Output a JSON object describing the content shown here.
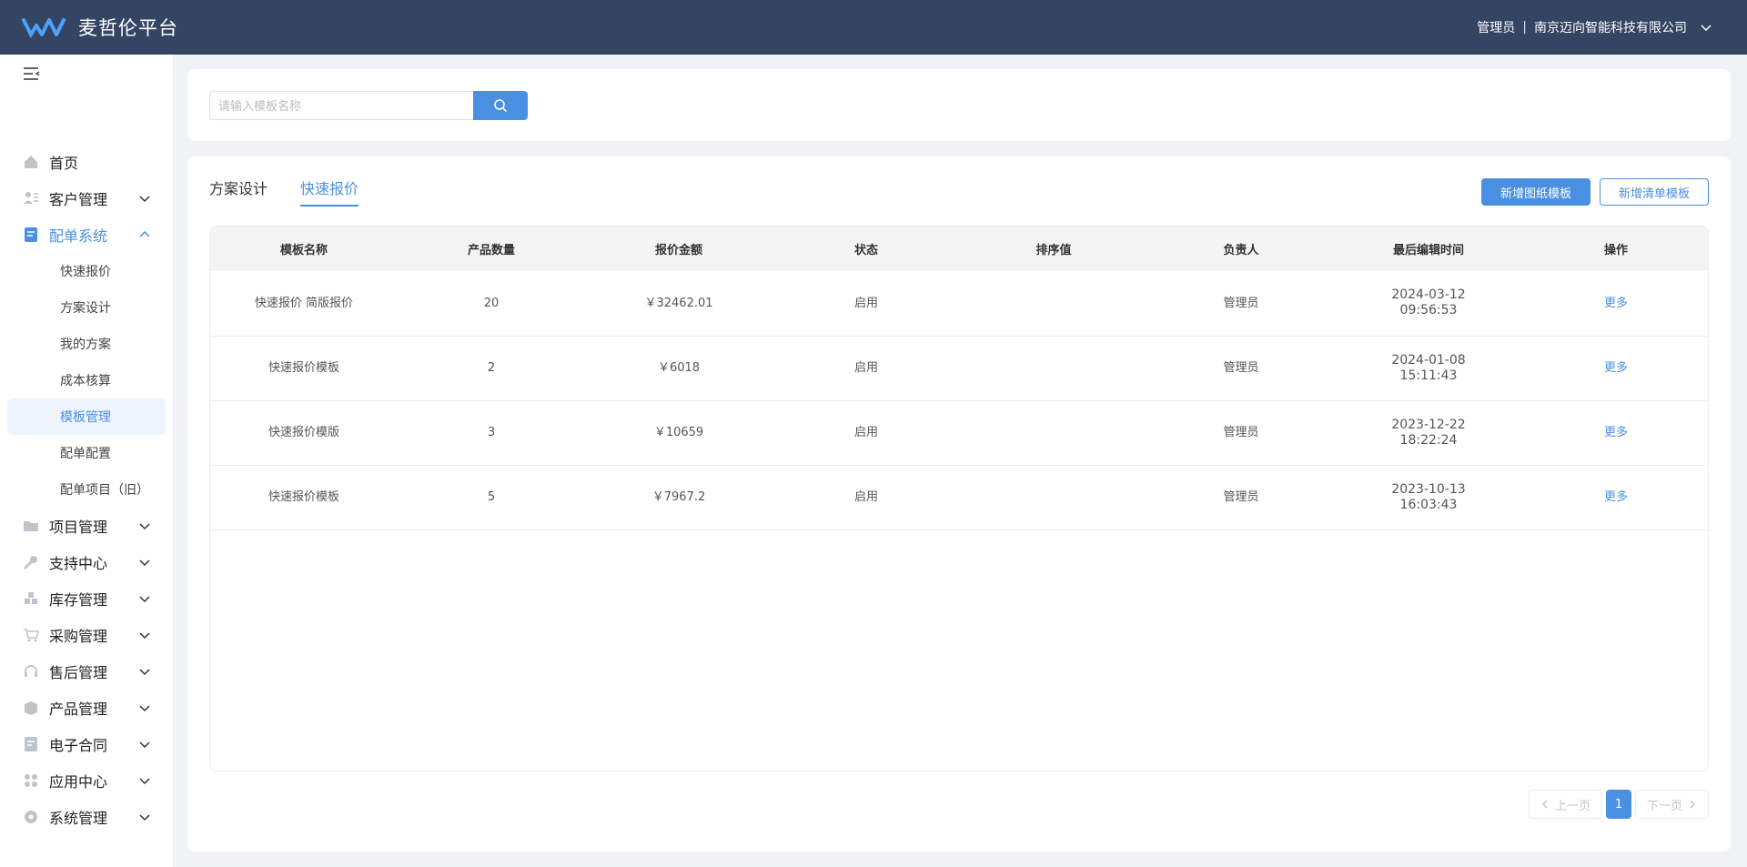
{
  "header": {
    "brand": "麦哲伦平台",
    "user": "管理员",
    "separator": "|",
    "company": "南京迈向智能科技有限公司"
  },
  "sidebar": {
    "items": [
      {
        "label": "首页",
        "icon": "home-icon"
      },
      {
        "label": "客户管理",
        "icon": "customer-icon"
      },
      {
        "label": "配单系统",
        "icon": "order-icon",
        "open": true,
        "children": [
          "快速报价",
          "方案设计",
          "我的方案",
          "成本核算",
          "模板管理",
          "配单配置",
          "配单项目（旧）"
        ],
        "active_child": "模板管理"
      },
      {
        "label": "项目管理",
        "icon": "folder-icon"
      },
      {
        "label": "支持中心",
        "icon": "wrench-icon"
      },
      {
        "label": "库存管理",
        "icon": "inventory-icon"
      },
      {
        "label": "采购管理",
        "icon": "cart-icon"
      },
      {
        "label": "售后管理",
        "icon": "headset-icon"
      },
      {
        "label": "产品管理",
        "icon": "box-icon"
      },
      {
        "label": "电子合同",
        "icon": "contract-icon"
      },
      {
        "label": "应用中心",
        "icon": "apps-icon"
      },
      {
        "label": "系统管理",
        "icon": "settings-icon"
      }
    ]
  },
  "search": {
    "placeholder": "请输入模板名称",
    "value": ""
  },
  "tabs": [
    {
      "label": "方案设计",
      "active": false
    },
    {
      "label": "快速报价",
      "active": true
    }
  ],
  "actions": {
    "add_drawing_template": "新增图纸模板",
    "add_list_template": "新增清单模板"
  },
  "table": {
    "columns": [
      "模板名称",
      "产品数量",
      "报价金额",
      "状态",
      "排序值",
      "负责人",
      "最后编辑时间",
      "操作"
    ],
    "rows": [
      {
        "name": "快速报价 简版报价",
        "qty": "20",
        "amount": "￥32462.01",
        "status": "启用",
        "sort": "",
        "owner": "管理员",
        "date": "2024-03-12",
        "time": "09:56:53",
        "action": "更多"
      },
      {
        "name": "快速报价模板",
        "qty": "2",
        "amount": "￥6018",
        "status": "启用",
        "sort": "",
        "owner": "管理员",
        "date": "2024-01-08",
        "time": "15:11:43",
        "action": "更多"
      },
      {
        "name": "快速报价模版",
        "qty": "3",
        "amount": "￥10659",
        "status": "启用",
        "sort": "",
        "owner": "管理员",
        "date": "2023-12-22",
        "time": "18:22:24",
        "action": "更多"
      },
      {
        "name": "快速报价模板",
        "qty": "5",
        "amount": "￥7967.2",
        "status": "启用",
        "sort": "",
        "owner": "管理员",
        "date": "2023-10-13",
        "time": "16:03:43",
        "action": "更多"
      }
    ]
  },
  "pagination": {
    "prev": "上一页",
    "current": "1",
    "next": "下一页"
  },
  "colors": {
    "header_bg": "#344563",
    "accent": "#4a90e2",
    "active_bg": "#eef4fd"
  }
}
